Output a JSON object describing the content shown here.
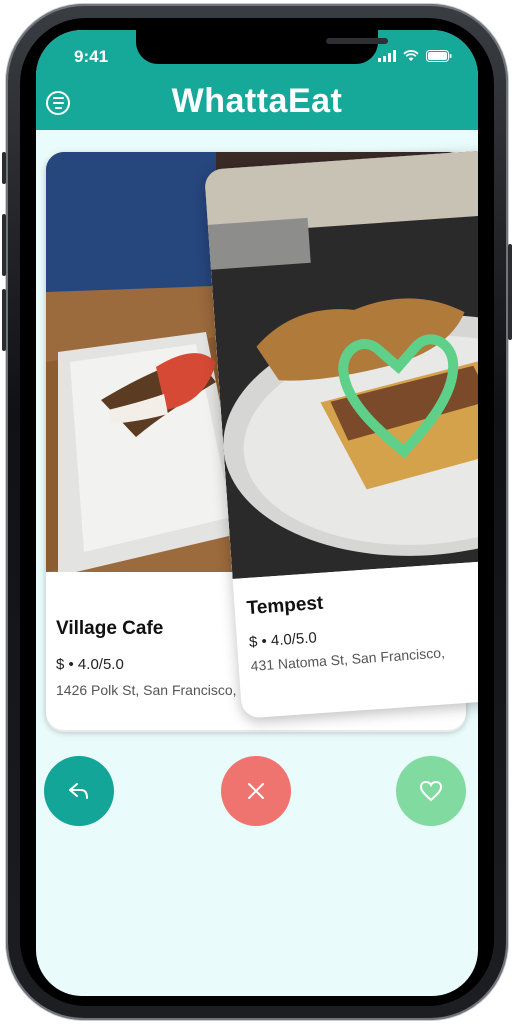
{
  "status_bar": {
    "time": "9:41"
  },
  "header": {
    "title": "WhattaEat",
    "menu_icon": "menu-icon"
  },
  "cards": [
    {
      "name": "Village Cafe",
      "meta": "$ • 4.0/5.0",
      "address": "1426 Polk St, San Francisco,"
    },
    {
      "name": "Tempest",
      "meta": "$ • 4.0/5.0",
      "address": "431 Natoma St, San Francisco,",
      "overlay_icon": "heart-icon"
    }
  ],
  "actions": [
    {
      "icon": "undo-icon",
      "color": "#13a597"
    },
    {
      "icon": "close-icon",
      "color": "#ef7470"
    },
    {
      "icon": "heart-icon",
      "color": "#81dba0"
    }
  ],
  "colors": {
    "header": "#16a99a",
    "background": "#e9fbfb",
    "like_overlay": "#5fd08a"
  }
}
